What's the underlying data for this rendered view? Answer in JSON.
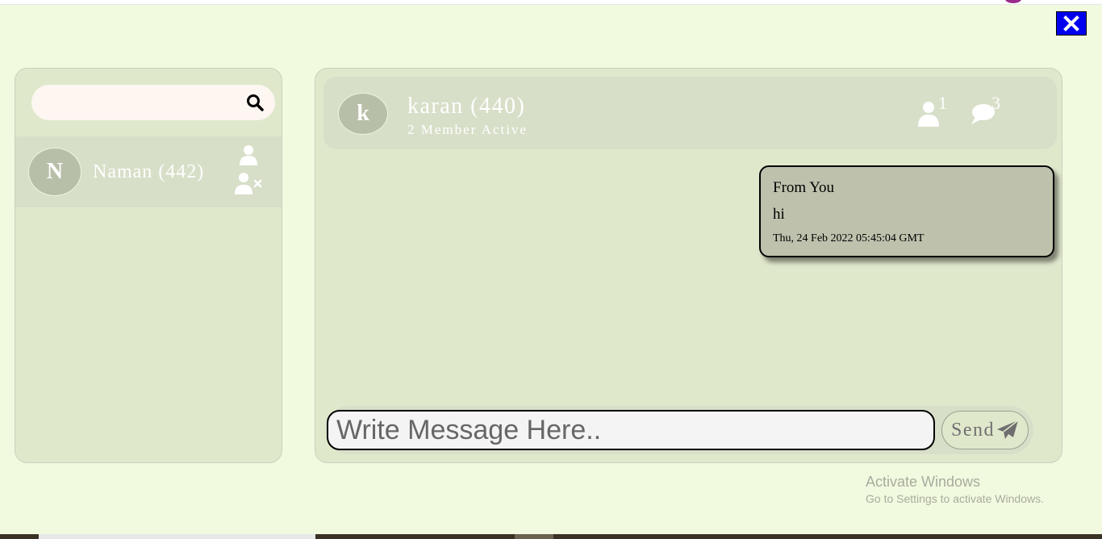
{
  "window": {
    "close_icon": "close-x-icon",
    "close_color": "#0000ee",
    "background": "#f1fadf"
  },
  "sidebar": {
    "search": {
      "placeholder": "",
      "value": "",
      "icon": "search-icon"
    },
    "contacts": [
      {
        "initial": "N",
        "name": "Naman (442)",
        "icons": [
          "user-icon",
          "remove-user-icon"
        ]
      }
    ]
  },
  "chat": {
    "header": {
      "initial": "k",
      "title": "karan (440)",
      "subtitle": "2 Member Active",
      "members_count": "1",
      "messages_count": "3"
    },
    "messages": [
      {
        "from": "From You",
        "text": "hi",
        "time": "Thu, 24 Feb 2022 05:45:04 GMT"
      }
    ],
    "composer": {
      "placeholder": "Write Message Here..",
      "send_label": "Send",
      "send_icon": "paper-plane-icon"
    }
  },
  "watermark": {
    "title": "Activate Windows",
    "subtitle": "Go to Settings to activate Windows."
  }
}
